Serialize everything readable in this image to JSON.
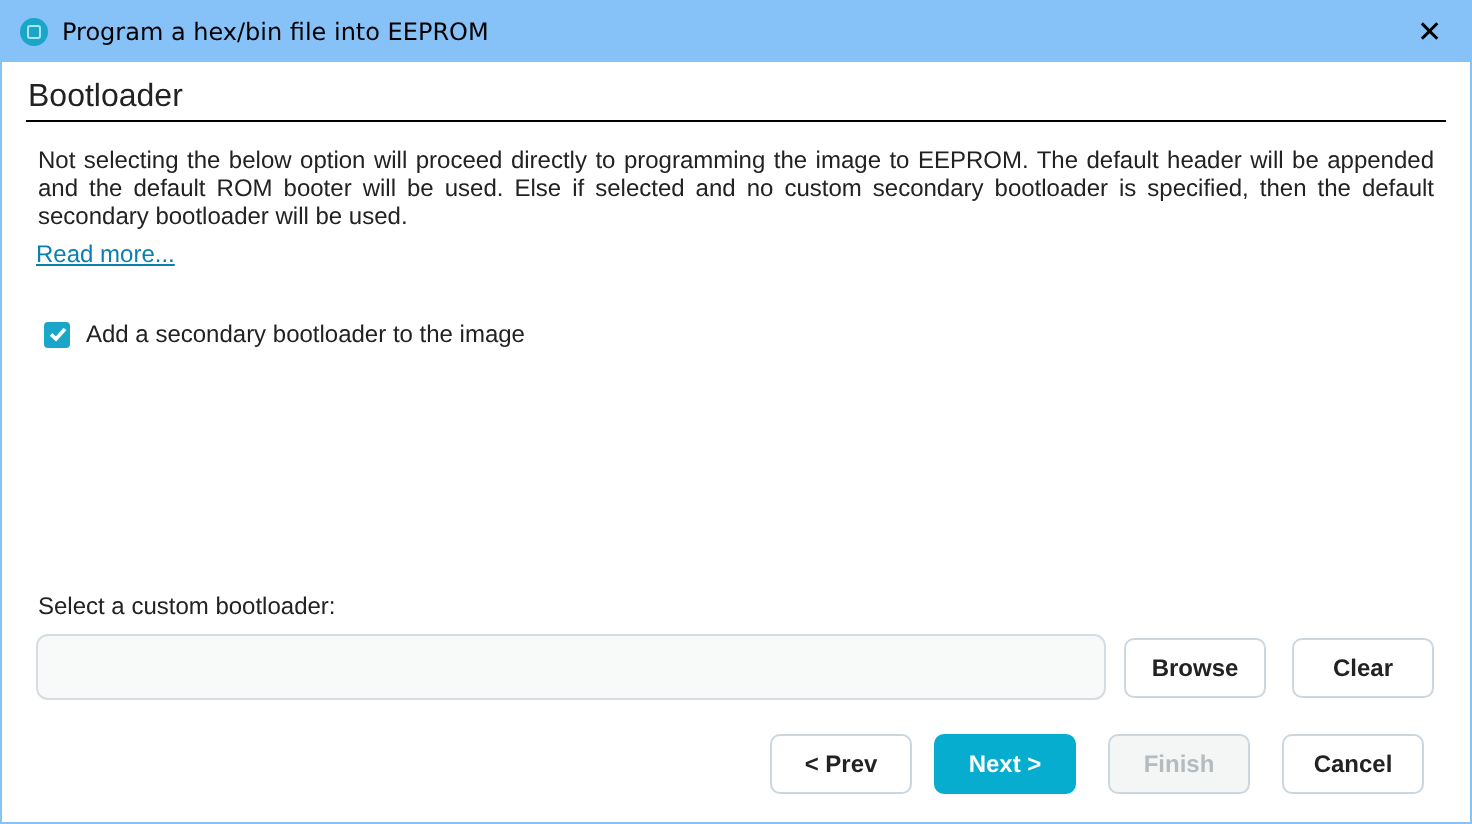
{
  "window": {
    "title": "Program a hex/bin file into EEPROM",
    "close": "✕"
  },
  "section": {
    "title": "Bootloader"
  },
  "description": "Not selecting the below option will proceed directly to programming the image to EEPROM. The default header will be appended and the default ROM booter will be used. Else if selected and no custom secondary bootloader is specified, then the default secondary bootloader will be used.",
  "read_more": "Read more...",
  "option": {
    "label": "Add a secondary bootloader to the image",
    "checked": true
  },
  "custom_bootloader": {
    "label": "Select a custom bootloader:",
    "buttons": [
      "Browse",
      "Clear"
    ]
  },
  "buttons": [
    {
      "label": "< Prev",
      "kind": "normal",
      "disabled": false
    },
    {
      "label": "Next >",
      "kind": "primary",
      "disabled": false
    },
    {
      "label": "Finish",
      "kind": "normal",
      "disabled": true
    },
    {
      "label": "Cancel",
      "kind": "normal",
      "disabled": false
    }
  ]
}
